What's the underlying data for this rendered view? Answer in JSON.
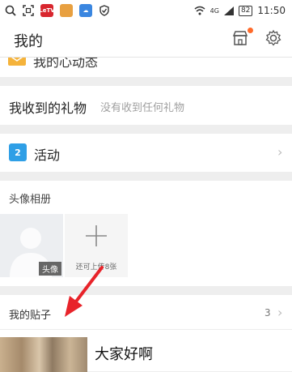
{
  "status_bar": {
    "network": "4G",
    "battery": "82",
    "time": "11:50",
    "app_badge": "LeTV"
  },
  "header": {
    "title": "我的"
  },
  "partial_row": {
    "label": "我的心动态"
  },
  "gifts": {
    "label": "我收到的礼物",
    "value": "没有收到任何礼物"
  },
  "activity": {
    "icon_text": "2",
    "label": "活动"
  },
  "album": {
    "title": "头像相册",
    "avatar_tag": "头像",
    "add_hint": "还可上传8张"
  },
  "posts": {
    "label": "我的贴子",
    "count": "3",
    "items": [
      {
        "title": "大家好啊"
      }
    ]
  },
  "colors": {
    "accent_blue": "#2f9fe6",
    "notification_dot": "#ff6a2a",
    "annotation_arrow": "#e8232a"
  }
}
